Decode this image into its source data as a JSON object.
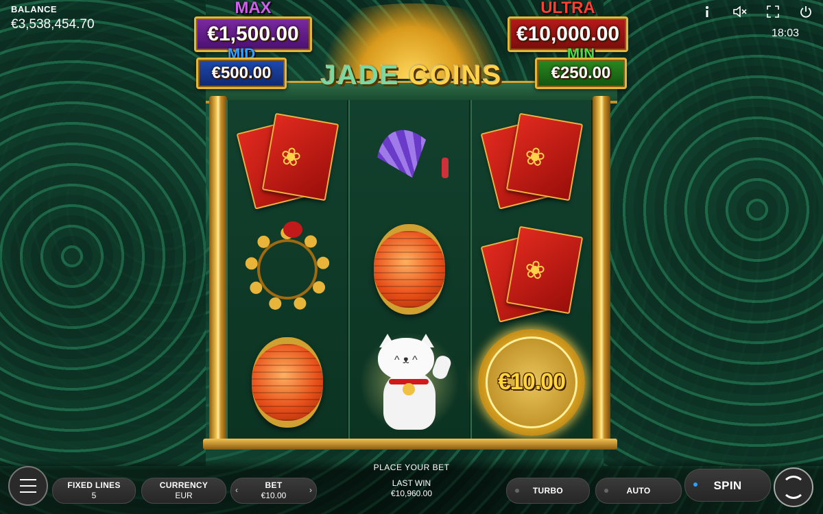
{
  "balance": {
    "label": "BALANCE",
    "value": "€3,538,454.70"
  },
  "clock": "18:03",
  "top_icons": [
    "info-icon",
    "sound-muted-icon",
    "fullscreen-icon",
    "power-icon"
  ],
  "jackpots": {
    "max": {
      "name": "MAX",
      "amount": "€1,500.00"
    },
    "ultra": {
      "name": "ULTRA",
      "amount": "€10,000.00"
    },
    "mid": {
      "name": "MID",
      "amount": "€500.00"
    },
    "min": {
      "name": "MIN",
      "amount": "€250.00"
    }
  },
  "logo": {
    "word1": "JADE",
    "word2": "COINS"
  },
  "reels": [
    [
      "red-envelope",
      "coin-string",
      "lantern"
    ],
    [
      "fan",
      "lantern",
      "lucky-cat"
    ],
    [
      "red-envelope",
      "red-envelope",
      "money-coin"
    ]
  ],
  "money_coin_value": "€10.00",
  "bottom": {
    "place_bet": "PLACE YOUR BET",
    "fixed_lines": {
      "label": "FIXED LINES",
      "value": "5"
    },
    "currency": {
      "label": "CURRENCY",
      "value": "EUR"
    },
    "bet": {
      "label": "BET",
      "value": "€10.00"
    },
    "last_win": {
      "label": "LAST WIN",
      "value": "€10,960.00"
    },
    "turbo": "TURBO",
    "auto": "AUTO",
    "spin": "SPIN"
  },
  "colors": {
    "max": "#d05ff0",
    "ultra": "#ff4030",
    "mid": "#3aa0ff",
    "min": "#4ae040",
    "gold": "#e3b73c"
  }
}
